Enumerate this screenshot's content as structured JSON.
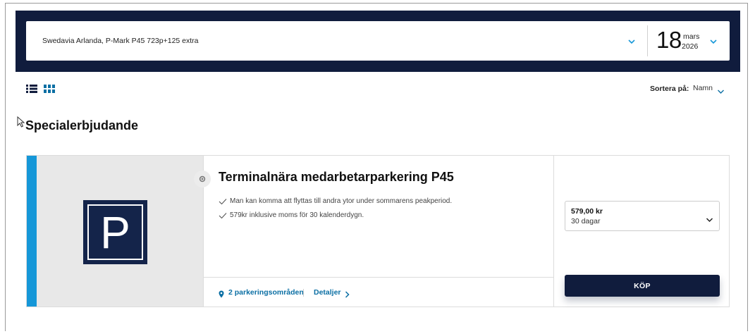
{
  "search": {
    "location": "Swedavia Arlanda, P-Mark P45 723p+125 extra",
    "date_day": "18",
    "date_month": "mars",
    "date_year": "2026"
  },
  "toolbar": {
    "sort_label": "Sortera på:",
    "sort_value": "Namn"
  },
  "section": {
    "title": "Specialerbjudande"
  },
  "product": {
    "title": "Terminalnära medarbetarparkering P45",
    "image_letter": "P",
    "features": [
      "Man kan komma att flyttas till andra ytor under sommarens peakperiod.",
      "579kr inklusive moms för 30 kalenderdygn."
    ],
    "areas_link": "2 parkeringsområden",
    "details_link": "Detaljer",
    "price": "579,00 kr",
    "duration": "30 dagar",
    "buy_label": "KÖP"
  },
  "colors": {
    "navy": "#101c3d",
    "accent": "#1597d8",
    "link": "#0b6fa4"
  },
  "icons": {
    "list_view": "list-view-icon",
    "grid_view": "grid-view-icon",
    "clock": "clock-icon",
    "pin": "map-pin-icon",
    "check": "check-icon"
  }
}
